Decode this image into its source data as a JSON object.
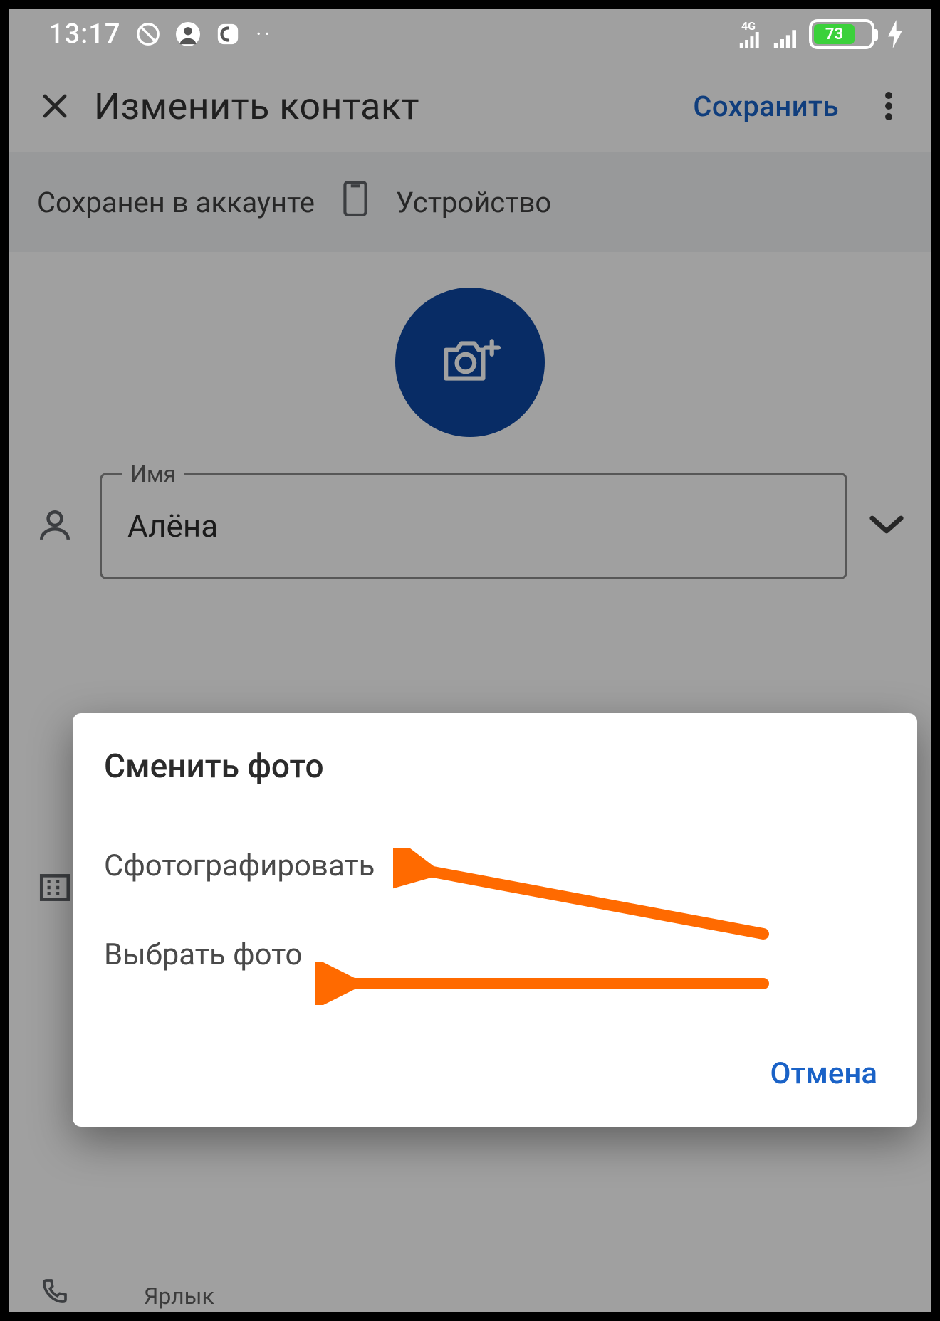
{
  "status_bar": {
    "time": "13:17",
    "network_label": "4G",
    "battery_percent": "73"
  },
  "app_bar": {
    "title": "Изменить контакт",
    "save_label": "Сохранить"
  },
  "saved_strip": {
    "prefix": "Сохранен в аккаунте",
    "location": "Устройство"
  },
  "fields": {
    "name_label": "Имя",
    "name_value": "Алёна",
    "secondary_label_partial": "Ярлык"
  },
  "dialog": {
    "title": "Сменить фото",
    "option_take": "Сфотографировать",
    "option_choose": "Выбрать фото",
    "cancel_label": "Отмена"
  }
}
